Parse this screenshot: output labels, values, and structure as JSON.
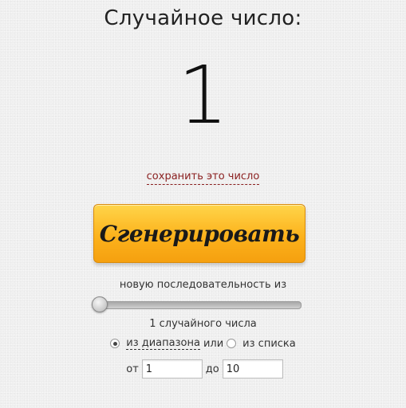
{
  "header": {
    "title": "Случайное число:"
  },
  "result": {
    "value": "1"
  },
  "actions": {
    "save_link": "сохранить это число",
    "generate_button": "Сгенерировать"
  },
  "sequence": {
    "label": "новую последовательность из",
    "count_label": "1 случайного числа",
    "slider_value": 1
  },
  "mode": {
    "selected": "range",
    "range_label": "из диапазона",
    "or_label": "или",
    "list_label": "из списка"
  },
  "range": {
    "from_label": "от",
    "from_value": "1",
    "to_label": "до",
    "to_value": "10"
  },
  "colors": {
    "button_top": "#ffd54a",
    "button_bottom": "#f5a00f",
    "link": "#8a1f1f"
  }
}
